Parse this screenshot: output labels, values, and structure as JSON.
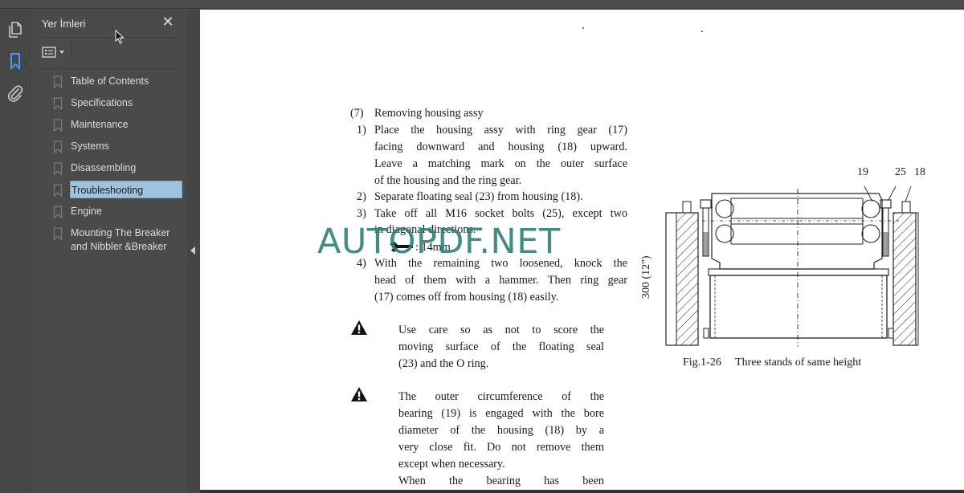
{
  "app": {
    "accent_color": "#4a9bef",
    "selection_color": "#9cc3e0",
    "watermark_color": "#2e7f7a"
  },
  "icon_rail": {
    "items": [
      {
        "name": "pages-icon",
        "active": false
      },
      {
        "name": "bookmark-icon",
        "active": true
      },
      {
        "name": "attachment-icon",
        "active": false
      }
    ]
  },
  "bookmarks_panel": {
    "title": "Yer İmleri",
    "close_glyph": "✕",
    "options_icon": "list-options-icon",
    "items": [
      {
        "label": "Table of Contents",
        "selected": false
      },
      {
        "label": "Specifications",
        "selected": false
      },
      {
        "label": "Maintenance",
        "selected": false
      },
      {
        "label": "Systems",
        "selected": false
      },
      {
        "label": "Disassembling",
        "selected": false
      },
      {
        "label": "Troubleshooting",
        "selected": true
      },
      {
        "label": "Engine",
        "selected": false
      },
      {
        "label": "Mounting The Breaker and Nibbler &Breaker",
        "selected": false
      }
    ]
  },
  "document": {
    "section_num": "(7)",
    "section_title": "Removing housing assy",
    "steps": [
      {
        "num": "1)",
        "lines": [
          "Place the housing assy with ring gear (17)",
          "facing downward and housing (18) upward.",
          "Leave a matching mark on the outer surface",
          "of the housing and the ring gear."
        ]
      },
      {
        "num": "2)",
        "lines": [
          "Separate floating seal (23) from housing (18)."
        ]
      },
      {
        "num": "3)",
        "lines": [
          "Take off all M16 socket bolts (25), except two",
          "in diagonal directions."
        ]
      },
      {
        "num": "4)",
        "lines": [
          "With the remaining two loosened, knock the",
          "head of them with a hammer. Then ring gear",
          "(17) comes off from housing (18) easily."
        ]
      }
    ],
    "tool_spec": ": 14mm",
    "tool_icon": "wrench-icon",
    "warnings": [
      {
        "lines": [
          "Use care so as not to score the",
          "moving surface of the floating seal",
          "(23) and the O ring."
        ]
      },
      {
        "lines": [
          "The outer circumference of the",
          "bearing (19) is engaged with the bore",
          "diameter of the housing (18) by a",
          "very close fit. Do not remove them",
          "except when necessary.",
          "When the bearing has been"
        ]
      }
    ],
    "figure": {
      "callouts": [
        "19",
        "25",
        "18"
      ],
      "dimension": "300 (12\")",
      "caption_num": "Fig.1-26",
      "caption_text": "Three stands of same height"
    },
    "watermark": "AUTOPDF.NET"
  }
}
